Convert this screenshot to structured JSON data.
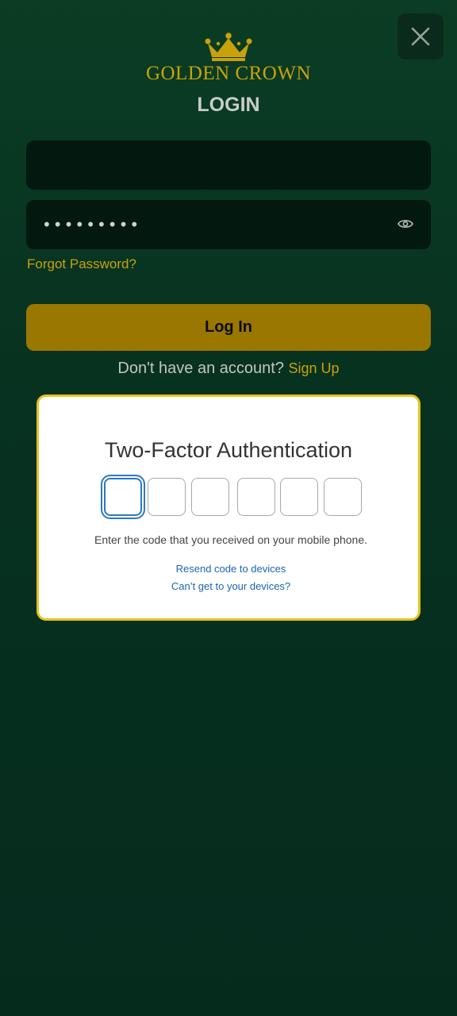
{
  "header": {
    "brand_name": "GOLDEN CROWN",
    "logo_icon": "crown-icon",
    "close_icon": "close-icon"
  },
  "login": {
    "title": "LOGIN",
    "username": {
      "value": "",
      "placeholder": ""
    },
    "password": {
      "value": "•••••••••",
      "show_password_icon": "eye-icon"
    },
    "forgot_password": "Forgot Password?",
    "login_button": "Log In",
    "no_account_text": "Don't have an account?",
    "sign_up": "Sign Up"
  },
  "two_factor": {
    "title": "Two-Factor Authentication",
    "code_digits": [
      "",
      "",
      "",
      "",
      "",
      ""
    ],
    "description": "Enter the code that you received on your mobile phone.",
    "resend_link": "Resend code to devices",
    "cant_get_link": "Can’t get to your devices?"
  },
  "colors": {
    "background": "#073120",
    "gold": "#c9a10a",
    "button": "#9a7700",
    "field": "#03190f",
    "card_border": "#e6c21a",
    "link_blue": "#1b64b5",
    "focus_blue": "#2b79c2"
  }
}
